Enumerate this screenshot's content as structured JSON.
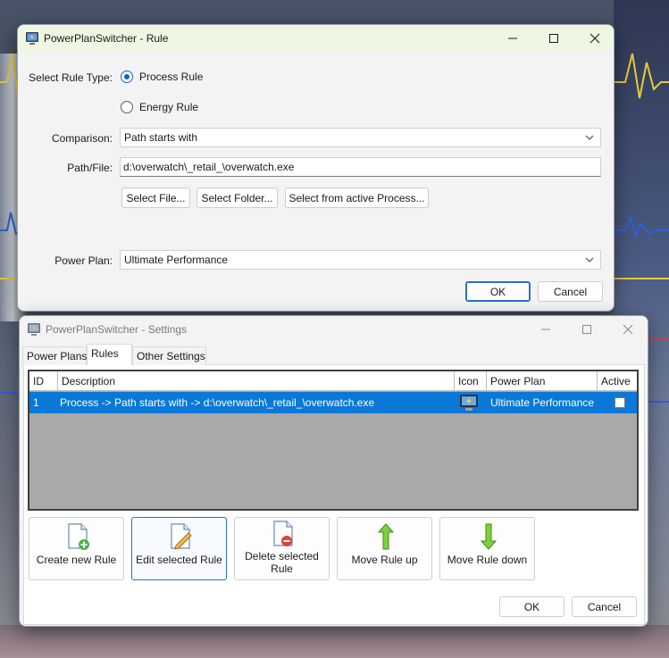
{
  "rule_dialog": {
    "title": "PowerPlanSwitcher - Rule",
    "select_rule_type_label": "Select Rule Type:",
    "rule_types": [
      {
        "label": "Process Rule",
        "selected": true
      },
      {
        "label": "Energy Rule",
        "selected": false
      }
    ],
    "comparison_label": "Comparison:",
    "comparison_value": "Path starts with",
    "path_label": "Path/File:",
    "path_value": "d:\\overwatch\\_retail_\\overwatch.exe",
    "select_file_button": "Select File...",
    "select_folder_button": "Select Folder...",
    "select_process_button": "Select from active Process...",
    "power_plan_label": "Power Plan:",
    "power_plan_value": "Ultimate Performance",
    "ok_button": "OK",
    "cancel_button": "Cancel"
  },
  "settings_window": {
    "title": "PowerPlanSwitcher - Settings",
    "tabs": [
      {
        "label": "Power Plans",
        "active": false
      },
      {
        "label": "Rules",
        "active": true
      },
      {
        "label": "Other Settings",
        "active": false
      }
    ],
    "grid": {
      "columns": [
        "ID",
        "Description",
        "Icon",
        "Power Plan",
        "Active"
      ],
      "rows": [
        {
          "id": "1",
          "description": "Process -> Path starts with -> d:\\overwatch\\_retail_\\overwatch.exe",
          "icon": "power-plan-icon",
          "power_plan": "Ultimate Performance",
          "active": false
        }
      ]
    },
    "action_buttons": [
      {
        "label": "Create new Rule",
        "icon": "new-document-icon"
      },
      {
        "label": "Edit selected Rule",
        "icon": "edit-document-icon"
      },
      {
        "label": "Delete selected Rule",
        "icon": "delete-document-icon"
      },
      {
        "label": "Move Rule up",
        "icon": "arrow-up-icon"
      },
      {
        "label": "Move Rule down",
        "icon": "arrow-down-icon"
      }
    ],
    "ok_button": "OK",
    "cancel_button": "Cancel"
  },
  "colors": {
    "selection": "#0a78d7",
    "accent": "#1a61c7",
    "icon_green": "#6bc22e"
  }
}
